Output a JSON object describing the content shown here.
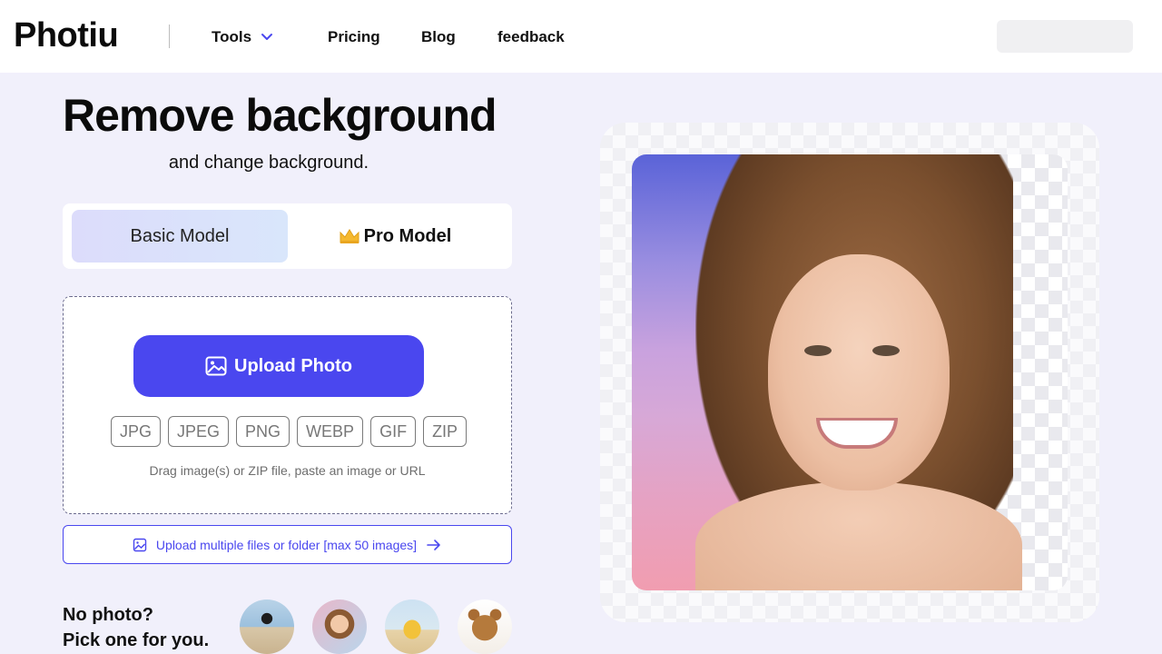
{
  "header": {
    "logo": "Photiu",
    "nav": {
      "tools": "Tools",
      "pricing": "Pricing",
      "blog": "Blog",
      "feedback": "feedback"
    }
  },
  "hero": {
    "title": "Remove background",
    "subtitle": "and change background."
  },
  "models": {
    "basic": "Basic Model",
    "pro": "Pro Model",
    "pro_icon": "crown-icon",
    "selected": "Basic Model"
  },
  "upload": {
    "button": "Upload Photo",
    "button_icon": "image-icon",
    "formats": [
      "JPG",
      "JPEG",
      "PNG",
      "WEBP",
      "GIF",
      "ZIP"
    ],
    "hint": "Drag image(s) or ZIP file, paste an image or URL",
    "multi": "Upload multiple files or folder [max 50 images]"
  },
  "samples": {
    "prompt_line1": "No photo?",
    "prompt_line2": "Pick one for you."
  },
  "colors": {
    "accent": "#4a47ef",
    "page_bg": "#f1f0fb"
  }
}
